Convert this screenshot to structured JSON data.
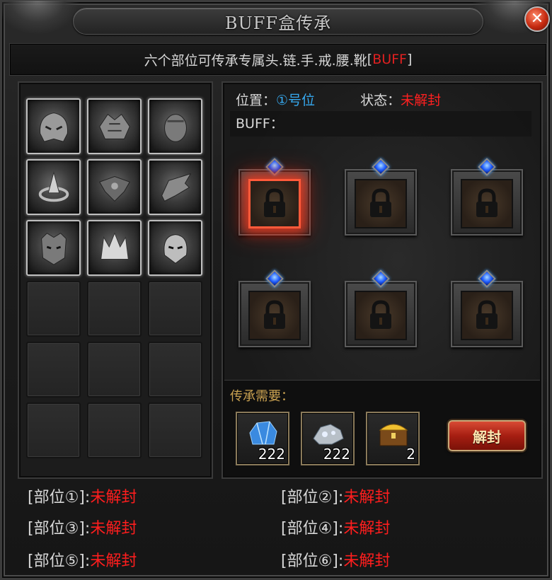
{
  "window": {
    "title": "BUFF盒传承",
    "close_icon": "close-icon"
  },
  "banner": {
    "text": "六个部位可传承专属头.链.手.戒.腰.靴",
    "buff_open": "[",
    "buff_label": "BUFF",
    "buff_close": "]"
  },
  "equipment": {
    "items": [
      {
        "name": "helmet-icon"
      },
      {
        "name": "shoulder-armor-icon"
      },
      {
        "name": "bracer-icon"
      },
      {
        "name": "ring-icon"
      },
      {
        "name": "belt-icon"
      },
      {
        "name": "boots-icon"
      },
      {
        "name": "mask-icon"
      },
      {
        "name": "crown-icon"
      },
      {
        "name": "face-helm-icon"
      }
    ],
    "empty_slots": 9
  },
  "detail": {
    "position_label": "位置：",
    "position_value": "①号位",
    "status_label": "状态：",
    "status_value": "未解封",
    "buff_label": "BUFF："
  },
  "locks": {
    "count": 6,
    "active_index": 0,
    "icon": "lock-icon"
  },
  "requirements": {
    "title": "传承需要：",
    "items": [
      {
        "icon": "blue-crystal-icon",
        "count": "222"
      },
      {
        "icon": "silver-ore-icon",
        "count": "222"
      },
      {
        "icon": "treasure-chest-icon",
        "count": "2"
      }
    ],
    "unlock_button": "解封"
  },
  "status_list": [
    {
      "label": "[部位①]:",
      "value": "未解封"
    },
    {
      "label": "[部位②]:",
      "value": "未解封"
    },
    {
      "label": "[部位③]:",
      "value": "未解封"
    },
    {
      "label": "[部位④]:",
      "value": "未解封"
    },
    {
      "label": "[部位⑤]:",
      "value": "未解封"
    },
    {
      "label": "[部位⑥]:",
      "value": "未解封"
    }
  ],
  "colors": {
    "blue_text": "#36a9f0",
    "red_text": "#ff1e1e",
    "gold_text": "#c8a050"
  }
}
